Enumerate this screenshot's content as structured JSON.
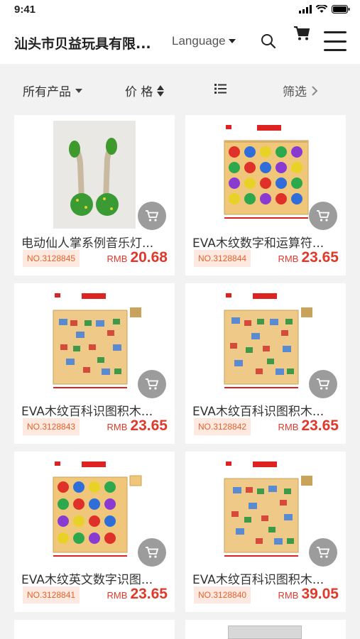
{
  "status": {
    "time": "9:41"
  },
  "header": {
    "title": "汕头市贝益玩具有限...",
    "language_label": "Language"
  },
  "sort_bar": {
    "all_products": "所有产品",
    "price": "价 格",
    "filter": "筛选"
  },
  "products": [
    {
      "name": "电动仙人掌系例音乐灯...",
      "number": "NO.3128845",
      "currency": "RMB",
      "price": "20.68",
      "image": "cactus-toy"
    },
    {
      "name": "EVA木纹数字和运算符...",
      "number": "NO.3128844",
      "currency": "RMB",
      "price": "23.65",
      "image": "number-blocks"
    },
    {
      "name": "EVA木纹百科识图积木...",
      "number": "NO.3128843",
      "currency": "RMB",
      "price": "23.65",
      "image": "picture-blocks"
    },
    {
      "name": "EVA木纹百科识图积木...",
      "number": "NO.3128842",
      "currency": "RMB",
      "price": "23.65",
      "image": "picture-blocks"
    },
    {
      "name": "EVA木纹英文数字识图...",
      "number": "NO.3128841",
      "currency": "RMB",
      "price": "23.65",
      "image": "letter-blocks"
    },
    {
      "name": "EVA木纹百科识图积木...",
      "number": "NO.3128840",
      "currency": "RMB",
      "price": "39.05",
      "image": "picture-blocks"
    }
  ]
}
